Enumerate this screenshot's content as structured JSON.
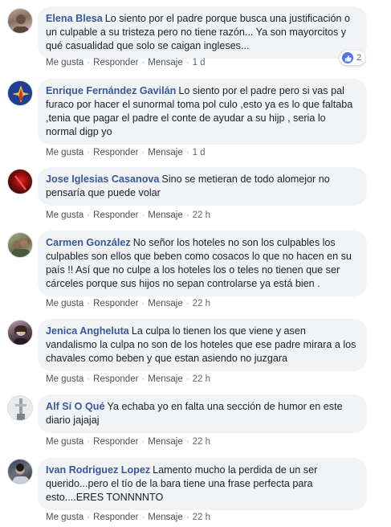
{
  "comments": [
    {
      "author": "Elena Blesa",
      "text": "Lo siento por el padre porque busca una justificación o un culpable a su tristeza pero no tiene razón... Ya son mayorcitos y qué casualidad que solo se caigan ingleses...",
      "like_label": "Me gusta",
      "reply_label": "Responder",
      "message_label": "Mensaje",
      "time": "1 d",
      "reaction_count": "2"
    },
    {
      "author": "Enrique Fernández Gavilán",
      "text": "Lo siento por el padre pero si vas pal furaco por hacer el sunormal toma pol culo ,esto ya es lo que faltaba ,tenia que pagar el padre el conte de ayudar a su hijp , seria lo normal digp yo",
      "like_label": "Me gusta",
      "reply_label": "Responder",
      "message_label": "Mensaje",
      "time": "1 d"
    },
    {
      "author": "Jose Iglesias Casanova",
      "text": "Sino se metieran de todo alomejor no pensaría que puede volar",
      "like_label": "Me gusta",
      "reply_label": "Responder",
      "message_label": "Mensaje",
      "time": "22 h"
    },
    {
      "author": "Carmen González",
      "text": "No señor los hoteles no son los culpables los culpables son ellos que beben como cosacos lo que no hacen en su país !! Así que no culpe a los hoteles los o teles no tienen que ser cárceles porque sus hijos no sepan controlarse ya está bien .",
      "like_label": "Me gusta",
      "reply_label": "Responder",
      "message_label": "Mensaje",
      "time": "22 h"
    },
    {
      "author": "Jenica Angheluta",
      "text": "La culpa lo tienen los que viene y asen vandalismo la culpa no son de los hoteles que ese padre mirara a los chavales como beben y que estan asiendo no juzgara",
      "like_label": "Me gusta",
      "reply_label": "Responder",
      "message_label": "Mensaje",
      "time": "22 h"
    },
    {
      "author": "Alf Sí O Qué",
      "text": "Ya echaba yo en falta una sección de humor en este diario jajajaj",
      "like_label": "Me gusta",
      "reply_label": "Responder",
      "message_label": "Mensaje",
      "time": "22 h"
    },
    {
      "author": "Ivan Rodriguez Lopez",
      "text": "Lamento mucho la perdida de un ser querido...pero el tío de la bara tiene una frase perfecta para esto....ERES TONNNNTO",
      "like_label": "Me gusta",
      "reply_label": "Responder",
      "message_label": "Mensaje",
      "time": "22 h"
    }
  ],
  "colors": {
    "author": "#385898",
    "bubble": "#f2f3f5",
    "like_blue": "#4a76e8"
  }
}
